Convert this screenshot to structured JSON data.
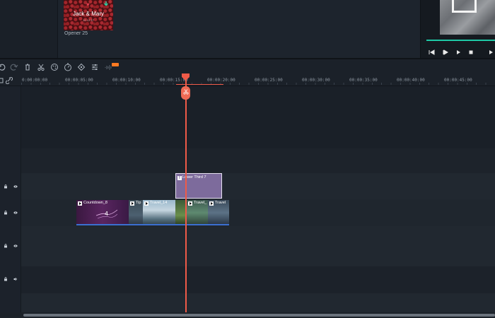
{
  "media": {
    "thumb_title": "Jack & Mary",
    "thumb_subtitle": "12.12.17",
    "caption": "Opener 25"
  },
  "toolbar": {
    "new_badge": "New",
    "icons": [
      "undo-icon",
      "redo-icon",
      "delete-icon",
      "cut-icon",
      "color-icon",
      "speed-icon",
      "keyframe-icon",
      "adjust-icon",
      "audio-icon"
    ]
  },
  "ruler": {
    "ticks": [
      "0:00:00:00",
      "00:00:05:00",
      "00:00:10:00",
      "00:00:15:00",
      "00:00:20:00",
      "00:00:25:00",
      "00:00:30:00",
      "00:00:35:00",
      "00:00:40:00",
      "00:00:45:00"
    ]
  },
  "clips": {
    "title": "Lower Third 7",
    "countdown": "Countdown_8",
    "tip": "Tip",
    "travel14": "Travel_14",
    "travel2": "Travel_",
    "travel3": "Travel"
  },
  "colors": {
    "playhead": "#ef5a48",
    "title_clip": "#7d6b9c",
    "preview_progress": "#1ec9a6",
    "new_badge": "#ff7a22"
  }
}
